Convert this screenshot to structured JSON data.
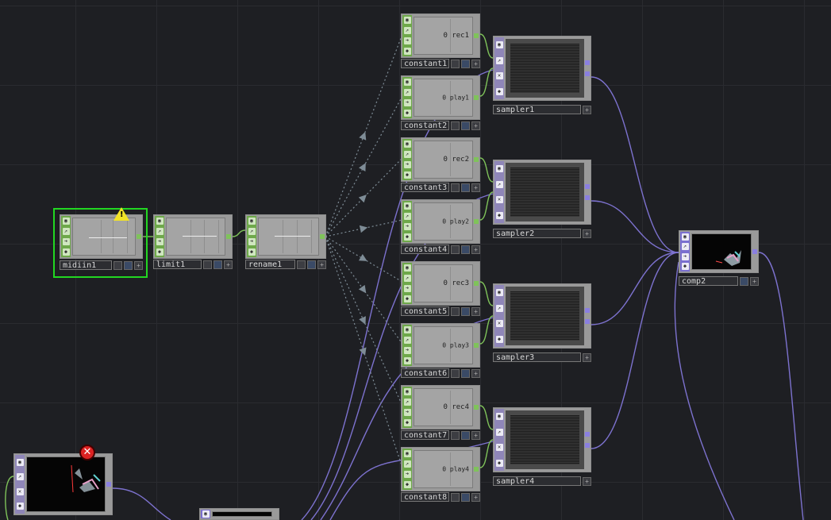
{
  "network": {
    "chop_nodes": [
      {
        "name": "midiin1",
        "value": ""
      },
      {
        "name": "limit1",
        "value": ""
      },
      {
        "name": "rename1",
        "value": ""
      },
      {
        "name": "constant1",
        "value": "0 rec1"
      },
      {
        "name": "constant2",
        "value": "0 play1"
      },
      {
        "name": "constant3",
        "value": "0 rec2"
      },
      {
        "name": "constant4",
        "value": "0 play2"
      },
      {
        "name": "constant5",
        "value": "0 rec3"
      },
      {
        "name": "constant6",
        "value": "0 play3"
      },
      {
        "name": "constant7",
        "value": "0 rec4"
      },
      {
        "name": "constant8",
        "value": "0 play4"
      }
    ],
    "top_nodes": [
      {
        "name": "sampler1"
      },
      {
        "name": "sampler2"
      },
      {
        "name": "sampler3"
      },
      {
        "name": "sampler4"
      }
    ],
    "comp_node": {
      "name": "comp2"
    },
    "warning_symbol": "!",
    "error_symbol": "✕",
    "colors": {
      "background": "#1e1f23",
      "chop_strip": "#6ea84a",
      "top_strip": "#8f86b8",
      "chop_wire": "#7fc35a",
      "top_wire": "#8a7fe0",
      "export_wire": "#6f7f8a",
      "selection": "#22d722",
      "warning": "#f2e226",
      "error": "#d22222"
    },
    "icons": [
      "viewer-flag-icon",
      "bypass-flag-icon",
      "cook-flag-icon",
      "lock-flag-icon",
      "warning-icon",
      "error-icon"
    ]
  }
}
